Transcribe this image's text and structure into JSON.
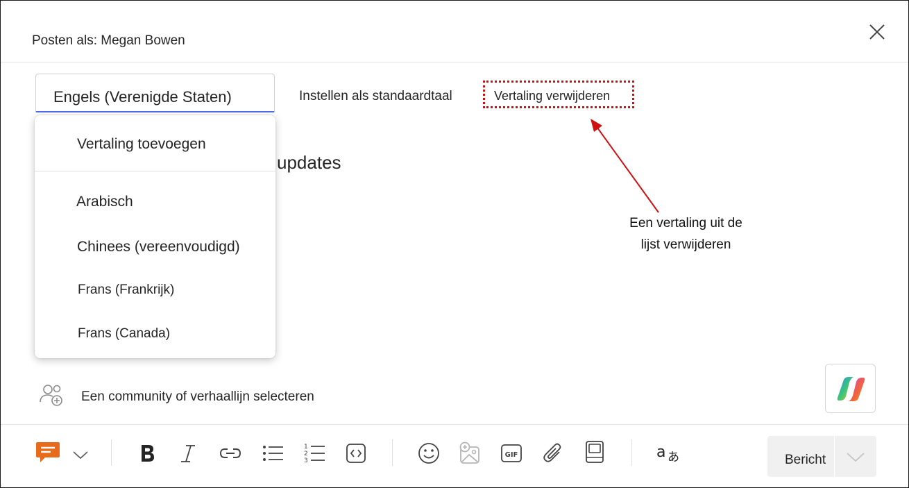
{
  "header": {
    "title": "Posten als: Megan Bowen",
    "close_icon": "close-icon"
  },
  "language": {
    "selected": "Engels (Verenigde Staten)",
    "set_default_label": "Instellen als standaardtaal",
    "remove_translation_label": "Vertaling verwijderen"
  },
  "dropdown": {
    "add_translation": "Vertaling toevoegen",
    "options": [
      "Arabisch",
      "Chinees (vereenvoudigd)",
      "Frans (Frankrijk)",
      "Frans (Canada)"
    ]
  },
  "editor": {
    "body_text_fragment": "updates"
  },
  "annotation": {
    "line1": "Een vertaling uit de",
    "line2": "lijst verwijderen",
    "color": "#d01010"
  },
  "community": {
    "label": "Een community of verhaallijn selecteren",
    "icon": "people-add-icon"
  },
  "toolbar": {
    "icons": [
      "post-type-icon",
      "chevron-down-icon",
      "bold-icon",
      "italic-icon",
      "link-icon",
      "bullet-list-icon",
      "numbered-list-icon",
      "code-icon",
      "emoji-icon",
      "image-icon",
      "gif-icon",
      "attach-icon",
      "sticker-icon",
      "translate-icon"
    ],
    "send_label": "Bericht",
    "accent_color": "#e86a1b"
  }
}
